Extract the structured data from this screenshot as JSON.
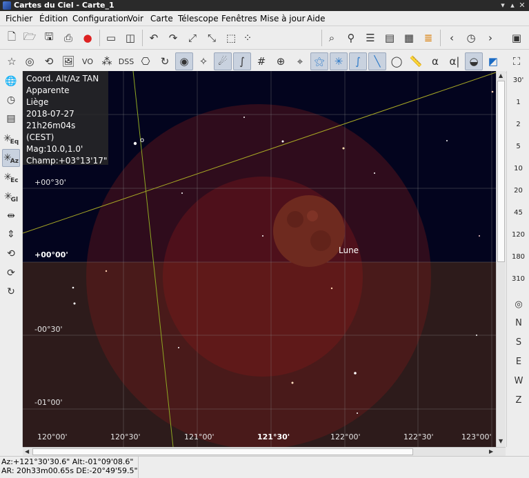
{
  "window": {
    "title": "Cartes du Ciel - Carte_1"
  },
  "menu": [
    "Fichier",
    "Édition",
    "Configuration",
    "Voir",
    "Carte",
    "Télescope",
    "Fenêtres",
    "Mise à jour",
    "Aide"
  ],
  "toolbar_search": {
    "value": ""
  },
  "toolbar2_text": {
    "vo": "VO",
    "dss": "DSS",
    "alpha": "α",
    "alpha_bracket": "α|"
  },
  "info_panel": [
    "Coord. Alt/Az TAN",
    "Apparente",
    "Liège",
    "2018-07-27",
    "21h26m04s (CEST)",
    "Mag:10.0,1.0'",
    "Champ:+03°13'17\""
  ],
  "chart_labels": {
    "moon": "Lune",
    "star_label": "o",
    "alt_labels": [
      "+00°30'",
      "+00°00'",
      "-00°30'",
      "-01°00'"
    ],
    "az_labels": [
      "120°00'",
      "120°30'",
      "121°00'",
      "121°30'",
      "122°00'",
      "122°30'",
      "123°00'"
    ]
  },
  "right_panel": {
    "fov_labels": [
      "30'",
      "1",
      "2",
      "5",
      "10",
      "20",
      "45",
      "120",
      "180",
      "310"
    ],
    "compass": [
      "N",
      "S",
      "E",
      "W",
      "Z"
    ]
  },
  "left_panel": {
    "eq": "Eq",
    "az": "Az",
    "ec": "Ec",
    "gl": "Gl"
  },
  "status": {
    "line1": "Az:+121°30'30.6\" Alt:-01°09'08.6\"",
    "line2": "AR: 20h33m00.65s DE:-20°49'59.5\""
  },
  "colors": {
    "sky": "#03041e",
    "ground": "#2d1b1b",
    "moon": "#7a2e22",
    "halo": "#7a1a1a",
    "horizon_line": "#a8a825"
  }
}
